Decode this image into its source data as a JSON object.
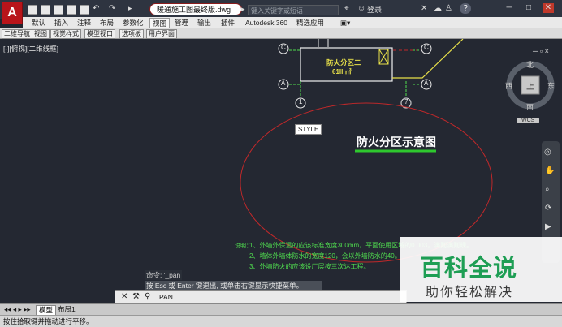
{
  "app": {
    "logo_letter": "A"
  },
  "titlebar": {
    "document": "暖通施工图最终版.dwg",
    "search_placeholder": "键入关键字或短语",
    "login": "登录"
  },
  "ribbon": {
    "tabs": [
      "默认",
      "插入",
      "注释",
      "布局",
      "参数化",
      "视图",
      "管理",
      "输出",
      "插件",
      "Autodesk 360",
      "精选应用"
    ],
    "active": "视图"
  },
  "file_tabs": [
    "二维导航",
    "视图",
    "视觉样式",
    "模型视口",
    "选项板",
    "用户界面"
  ],
  "viewport_label": "[-][俯视][二维线框]",
  "drawing": {
    "room_name": "防火分区二",
    "room_area": "61ll ㎡",
    "axis_labels": {
      "C": "C",
      "A": "A",
      "n1": "1",
      "n7": "7"
    },
    "style_tooltip": "STYLE",
    "heading": "防火分区示意图",
    "notes_lead": "说明：",
    "notes": [
      "1、外墙外保温的应该标准宽度300mm，平面使用区域的0.003，满则满则规。",
      "2、墙体外墙体防水的宽度120，会以外墙防水的40。",
      "3、外墙防火的应该设厂层按三次达工程。"
    ],
    "colors": {
      "bg": "#242832",
      "green": "#4fdc4f",
      "yellow": "#e8e04a",
      "red": "#c0282a"
    }
  },
  "viewcube": {
    "north": "北",
    "south": "南",
    "east": "东",
    "west": "西",
    "top": "上",
    "wcs": "WCS"
  },
  "command": {
    "history": [
      "命令: '_pan",
      "按 Esc 或 Enter 键退出, 或单击右键显示快捷菜单。"
    ],
    "current": "PAN"
  },
  "layout_tabs": [
    "模型",
    "布局1"
  ],
  "status": "按住拾取键并拖动进行平移。",
  "watermark": {
    "main": "百科全说",
    "sub": "助你轻松解决"
  }
}
